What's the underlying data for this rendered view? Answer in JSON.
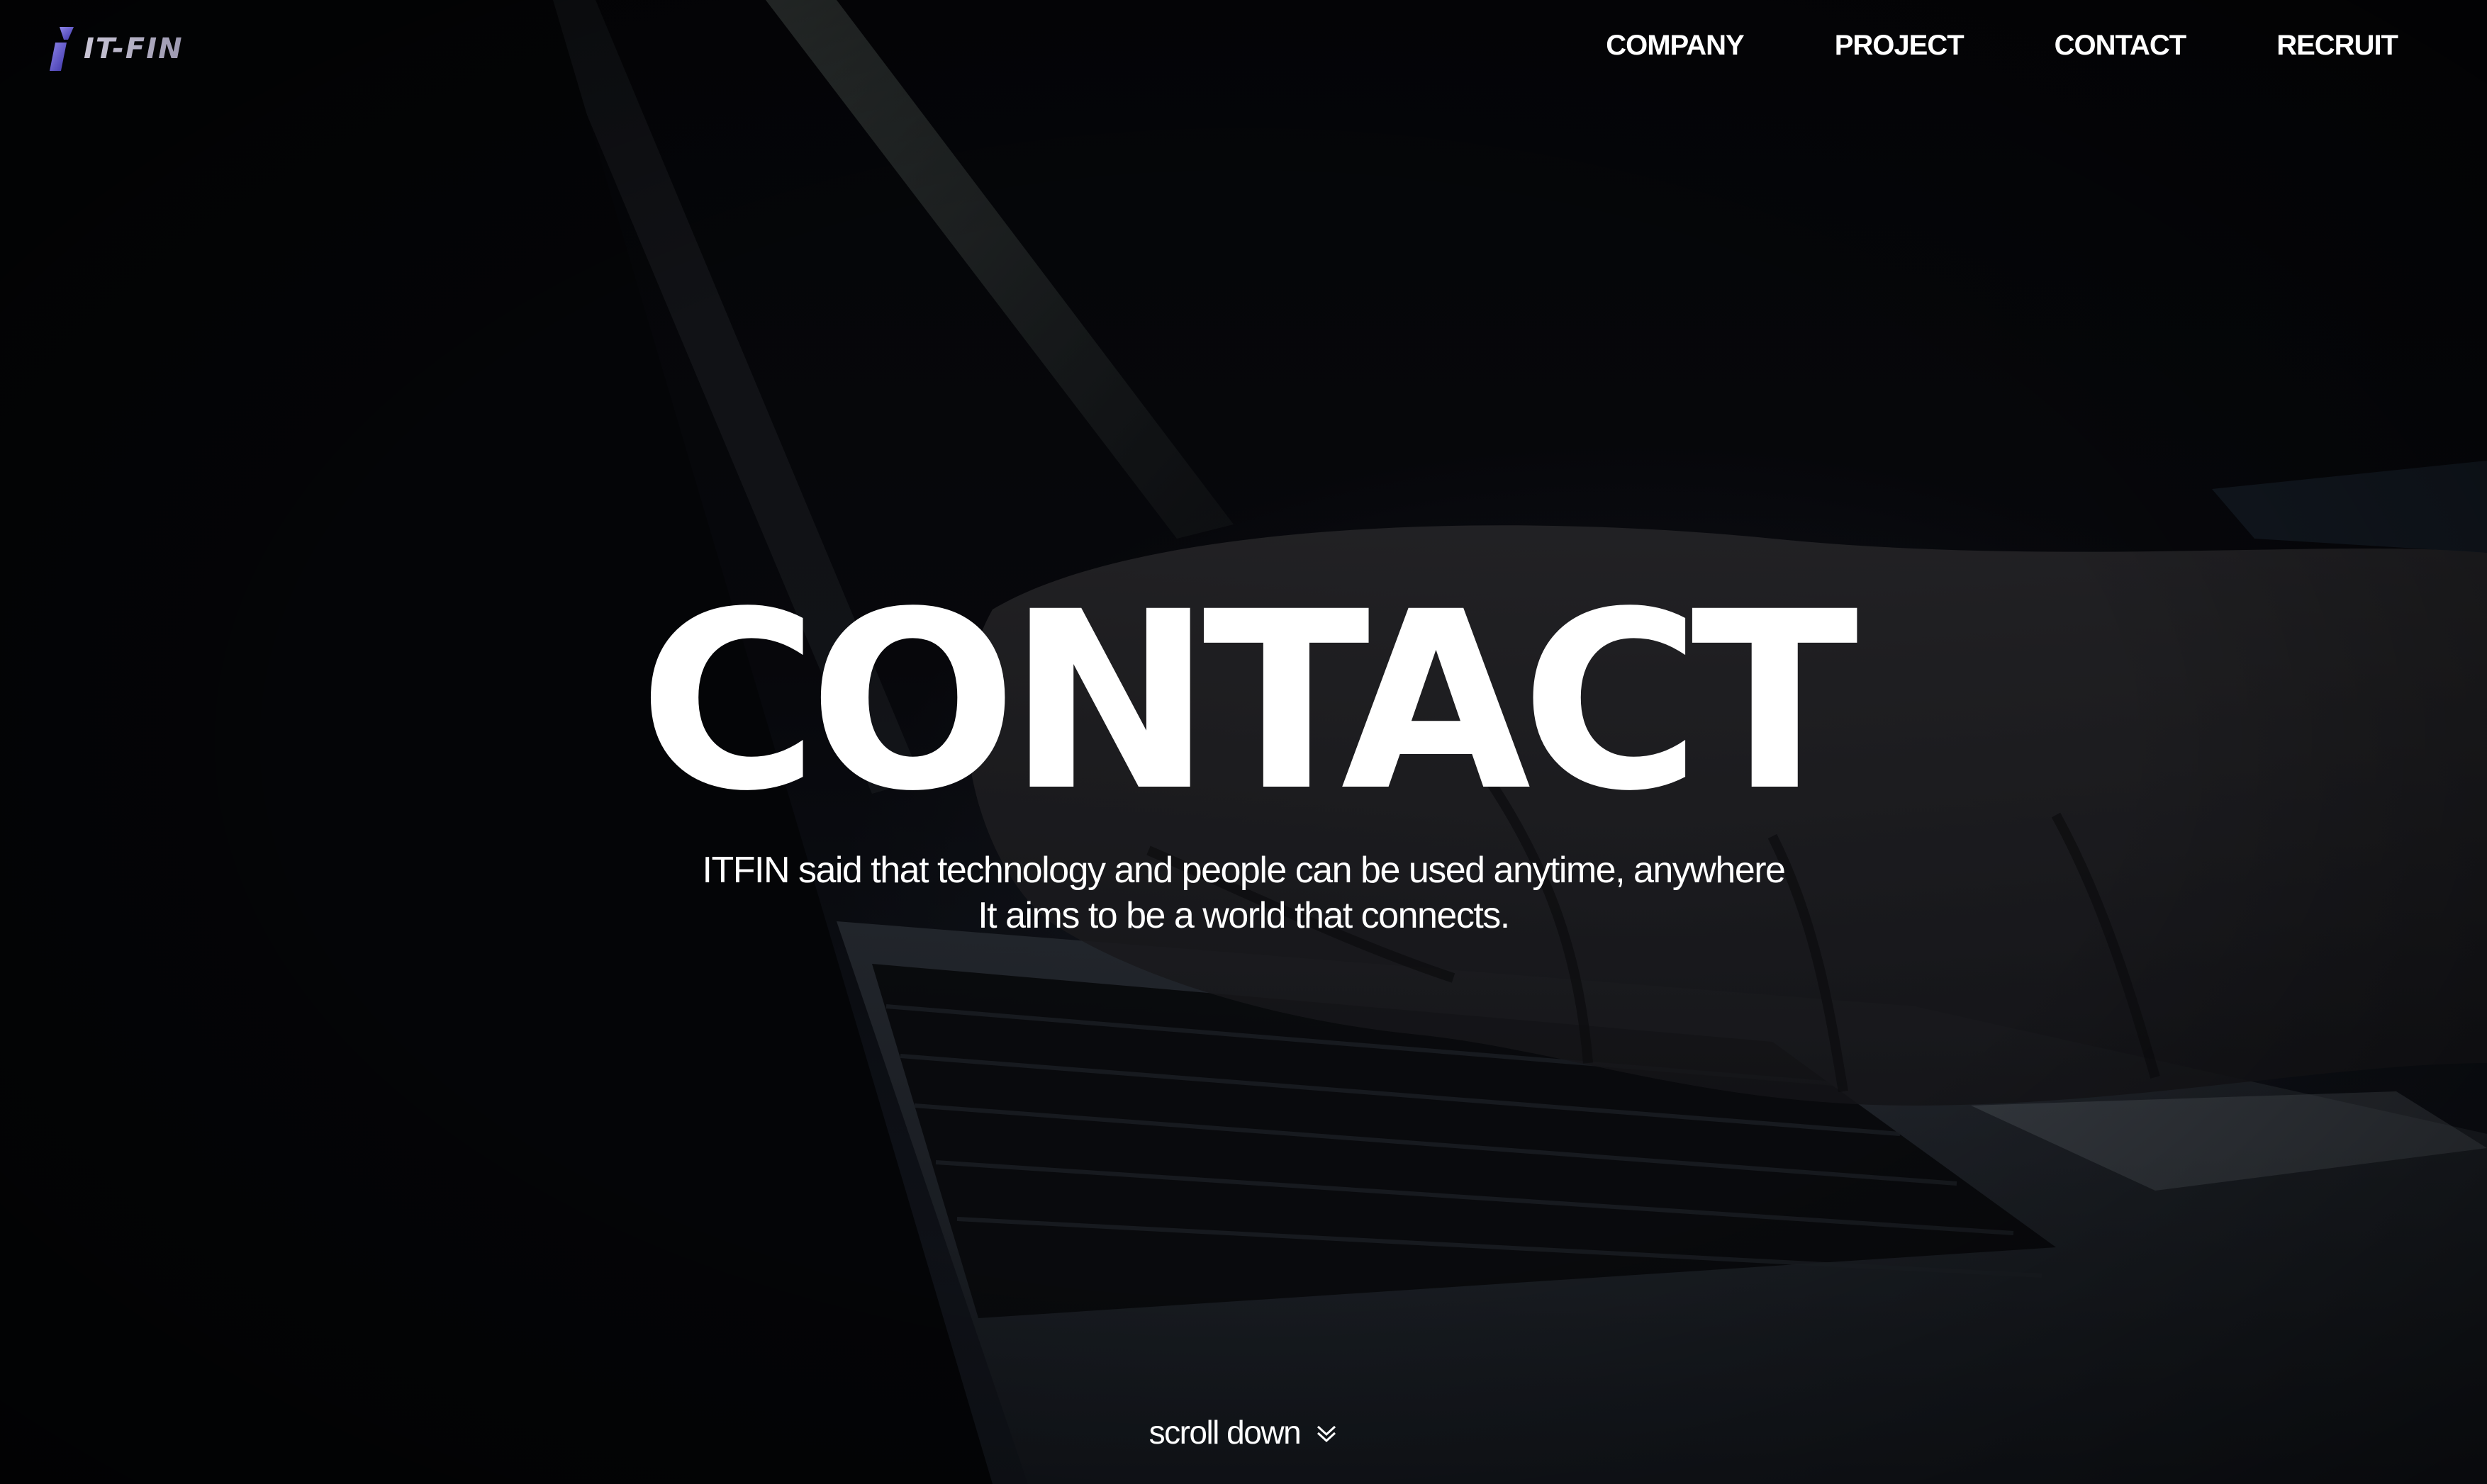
{
  "header": {
    "logo_text": "IT-FIN",
    "nav": [
      {
        "label": "COMPANY"
      },
      {
        "label": "PROJECT"
      },
      {
        "label": "CONTACT"
      },
      {
        "label": "RECRUIT"
      }
    ]
  },
  "hero": {
    "title": "CONTACT",
    "subtitle_line1": "ITFIN said that technology and people can be used anytime, anywhere",
    "subtitle_line2": "It aims to be a world that connects.",
    "scroll_label": "scroll down"
  },
  "colors": {
    "text": "#ffffff",
    "background": "#0a0b10",
    "logo_accent": "#6a5fd8"
  },
  "icons": {
    "logo_mark": "itfin-logo-mark",
    "scroll": "double-chevron-down-icon"
  }
}
